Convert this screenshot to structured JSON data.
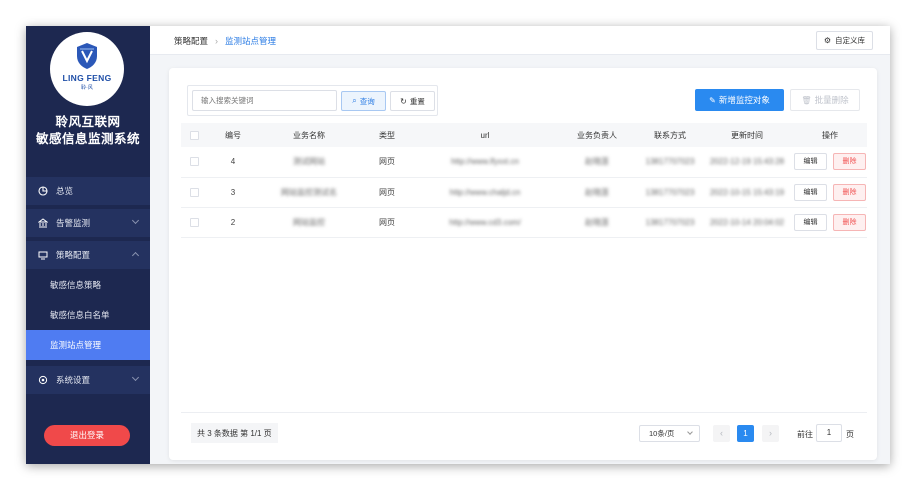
{
  "sidebar": {
    "logo_text": "LING FENG",
    "logo_sub": "聆·风",
    "title_line1": "聆风互联网",
    "title_line2": "敏感信息监测系统",
    "menu": {
      "overview": "总览",
      "alerts": "告警监测",
      "strategy": "策略配置",
      "sub_policy": "敏感信息策略",
      "sub_whitelist": "敏感信息白名单",
      "sub_sites": "监测站点管理",
      "settings": "系统设置"
    },
    "logout": "退出登录"
  },
  "header": {
    "breadcrumb_parent": "策略配置",
    "breadcrumb_current": "监测站点管理",
    "custom_lib_button": "自定义库"
  },
  "toolbar": {
    "search_placeholder": "输入搜索关键词",
    "query_button": "查询",
    "reset_button": "重置",
    "add_button": "新增监控对象",
    "batch_delete_button": "批量删除"
  },
  "table": {
    "columns": [
      "编号",
      "业务名称",
      "类型",
      "url",
      "业务负责人",
      "联系方式",
      "更新时间",
      "操作"
    ],
    "rows": [
      {
        "id": "4",
        "name": "测试网站",
        "type": "网页",
        "url": "http://www.lfyxxt.cn",
        "owner": "赵晓莲",
        "phone": "13817707023",
        "updated": "2022-12-19 15:43:28"
      },
      {
        "id": "3",
        "name": "网站监控测试名",
        "type": "网页",
        "url": "http://www.chaljd.cn",
        "owner": "赵晓莲",
        "phone": "13817707023",
        "updated": "2022-10-15 15:43:19"
      },
      {
        "id": "2",
        "name": "网站监控",
        "type": "网页",
        "url": "http://www.cd3.com/",
        "owner": "赵晓莲",
        "phone": "13817707023",
        "updated": "2022-10-14 20:04:02"
      }
    ],
    "edit_label": "编辑",
    "delete_label": "删除"
  },
  "pagination": {
    "summary": "共 3 条数据  第 1/1 页",
    "page_size": "10条/页",
    "current_page": "1",
    "goto_label": "前往",
    "goto_value": "1",
    "goto_unit": "页"
  },
  "colors": {
    "sidebar_bg": "#1d2850",
    "active_item": "#4f7cf2",
    "primary": "#2a8af0",
    "danger": "#f0494a"
  }
}
